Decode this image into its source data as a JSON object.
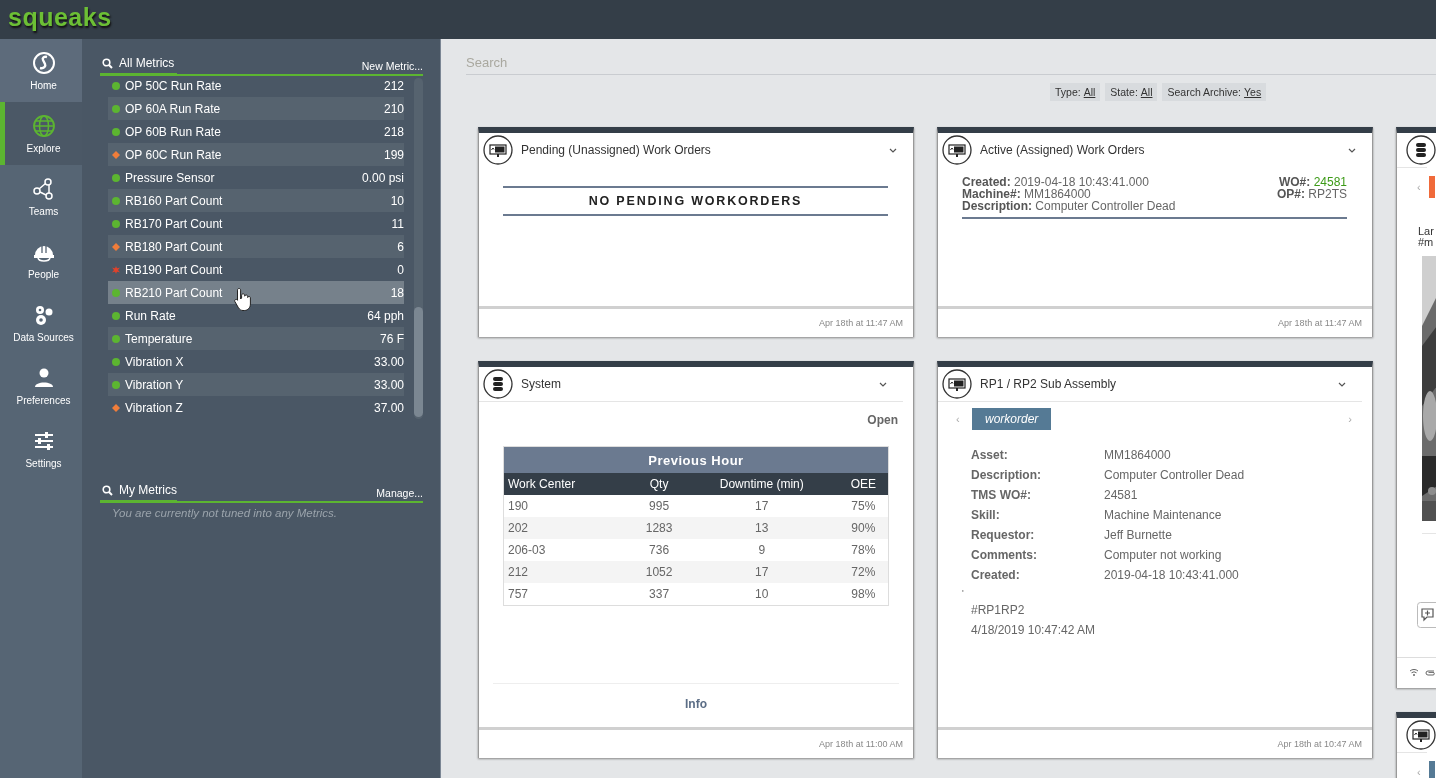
{
  "app": {
    "logo": "squeaks"
  },
  "nav": [
    {
      "label": "Home",
      "selected": false
    },
    {
      "label": "Explore",
      "selected": true
    },
    {
      "label": "Teams",
      "selected": false
    },
    {
      "label": "People",
      "selected": false
    },
    {
      "label": "Data Sources",
      "selected": false
    },
    {
      "label": "Preferences",
      "selected": false
    },
    {
      "label": "Settings",
      "selected": false
    }
  ],
  "all_metrics": {
    "title": "All Metrics",
    "action": "New Metric...",
    "items": [
      {
        "name": "OP 50C Run Rate",
        "value": "212",
        "kind": "ok",
        "selected": false
      },
      {
        "name": "OP 60A Run Rate",
        "value": "210",
        "kind": "ok",
        "selected": false
      },
      {
        "name": "OP 60B Run Rate",
        "value": "218",
        "kind": "ok",
        "selected": false
      },
      {
        "name": "OP 60C Run Rate",
        "value": "199",
        "kind": "warning",
        "selected": false
      },
      {
        "name": "Pressure Sensor",
        "value": "0.00 psi",
        "kind": "ok",
        "selected": false
      },
      {
        "name": "RB160 Part Count",
        "value": "10",
        "kind": "ok",
        "selected": false
      },
      {
        "name": "RB170 Part Count",
        "value": "11",
        "kind": "ok",
        "selected": false
      },
      {
        "name": "RB180 Part Count",
        "value": "6",
        "kind": "warning",
        "selected": false
      },
      {
        "name": "RB190 Part Count",
        "value": "0",
        "kind": "alarm",
        "selected": false
      },
      {
        "name": "RB210 Part Count",
        "value": "18",
        "kind": "ok",
        "selected": true
      },
      {
        "name": "Run Rate",
        "value": "64 pph",
        "kind": "ok",
        "selected": false
      },
      {
        "name": "Temperature",
        "value": "76 F",
        "kind": "ok",
        "selected": false
      },
      {
        "name": "Vibration X",
        "value": "33.00",
        "kind": "ok",
        "selected": false
      },
      {
        "name": "Vibration Y",
        "value": "33.00",
        "kind": "ok",
        "selected": false
      },
      {
        "name": "Vibration Z",
        "value": "37.00",
        "kind": "warning",
        "selected": false
      }
    ]
  },
  "my_metrics": {
    "title": "My Metrics",
    "action": "Manage...",
    "empty_text": "You are currently not tuned into any Metrics."
  },
  "search": {
    "placeholder": "Search"
  },
  "filters": [
    {
      "label": "Type:",
      "value": "All"
    },
    {
      "label": "State:",
      "value": "All"
    },
    {
      "label": "Search Archive:",
      "value": "Yes"
    }
  ],
  "columns": [
    [
      {
        "kind": "notice",
        "title": "Pending (Unassigned) Work Orders",
        "message": "NO PENDING WORKORDERS",
        "timestamp": "Apr 18th at 11:47 AM"
      },
      {
        "kind": "table",
        "title": "System",
        "link": "Open",
        "table": {
          "title": "Previous Hour",
          "columns": [
            "Work Center",
            "Qty",
            "Downtime (min)",
            "OEE"
          ],
          "rows": [
            [
              "190",
              "995",
              "17",
              "75%"
            ],
            [
              "202",
              "1283",
              "13",
              "90%"
            ],
            [
              "206-03",
              "736",
              "9",
              "78%"
            ],
            [
              "212",
              "1052",
              "17",
              "72%"
            ],
            [
              "757",
              "337",
              "10",
              "98%"
            ]
          ]
        },
        "footer_link": "Info",
        "timestamp": "Apr 18th at 11:00 AM"
      }
    ],
    [
      {
        "kind": "summary",
        "title": "Active (Assigned) Work Orders",
        "left": [
          {
            "label": "Created:",
            "value": "2019-04-18 10:43:41.000"
          },
          {
            "label": "Machine#:",
            "value": "MM1864000"
          },
          {
            "label": "Description:",
            "value": "Computer Controller Dead"
          }
        ],
        "right": [
          {
            "label": "WO#:",
            "value": "24581",
            "highlight": true
          },
          {
            "label": "OP#:",
            "value": "RP2TS",
            "highlight": false
          }
        ],
        "timestamp": "Apr 18th at 11:47 AM"
      },
      {
        "kind": "detail",
        "title": "RP1 / RP2 Sub Assembly",
        "prev": "‹",
        "tab": "workorder",
        "next": "›",
        "fields": [
          {
            "label": "Asset:",
            "value": "MM1864000"
          },
          {
            "label": "Description:",
            "value": "Computer Controller Dead"
          },
          {
            "label": "TMS WO#:",
            "value": "24581"
          },
          {
            "label": "Skill:",
            "value": "Machine Maintenance"
          },
          {
            "label": "Requestor:",
            "value": "Jeff Burnette"
          },
          {
            "label": "Comments:",
            "value": "Computer not working"
          },
          {
            "label": "Created:",
            "value": "2019-04-18 10:43:41.000"
          }
        ],
        "mark": "'",
        "notes": [
          "#RP1RP2",
          "4/18/2019 10:47:42 AM"
        ],
        "timestamp": "Apr 18th at 10:47 AM"
      }
    ],
    [
      {
        "kind": "feed",
        "prev": "‹",
        "lines": [
          "Lar",
          "#m"
        ]
      },
      {
        "kind": "partial",
        "prev": "‹"
      }
    ]
  ]
}
